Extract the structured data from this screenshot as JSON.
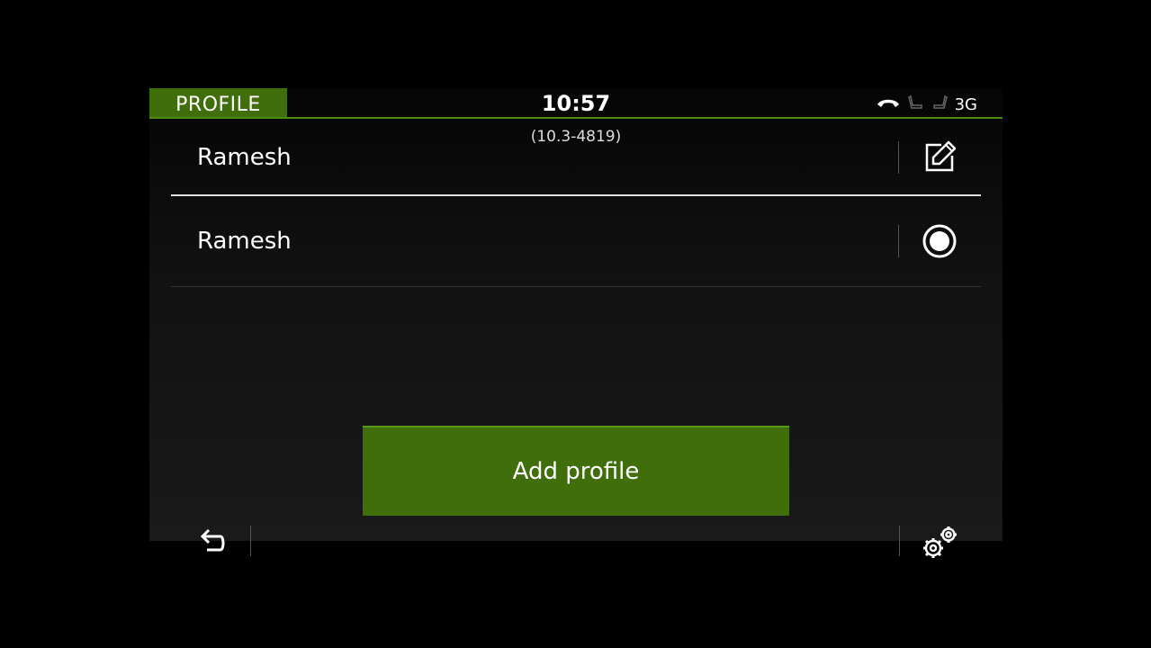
{
  "status_bar": {
    "tab_label": "PROFILE",
    "time": "10:57",
    "network": "3G",
    "icons": [
      "call-end-icon",
      "seat-icon",
      "seat-icon"
    ]
  },
  "version": "(10.3-4819)",
  "profiles": [
    {
      "name": "Ramesh",
      "action_icon": "edit-icon"
    },
    {
      "name": "Ramesh",
      "action_icon": "radio-selected-icon"
    }
  ],
  "add_profile_label": "Add profile",
  "bottom_bar": {
    "back_icon": "back-arrow-icon",
    "settings_icon": "gears-icon"
  },
  "colors": {
    "accent_green": "#3f6e0b",
    "accent_line": "#4d8a12",
    "background": "#000000"
  }
}
